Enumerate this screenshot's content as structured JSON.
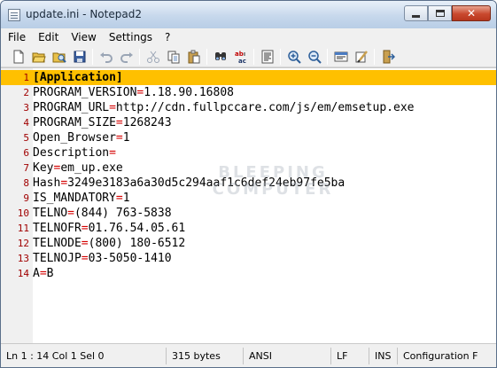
{
  "window": {
    "title": "update.ini - Notepad2"
  },
  "menu": {
    "items": [
      "File",
      "Edit",
      "View",
      "Settings",
      "?"
    ]
  },
  "toolbar": {
    "buttons": [
      "new-icon",
      "open-icon",
      "browse-icon",
      "save-icon",
      "undo-icon",
      "redo-icon",
      "cut-icon",
      "copy-icon",
      "paste-icon",
      "find-icon",
      "replace-icon",
      "word-wrap-icon",
      "zoom-in-icon",
      "zoom-out-icon",
      "schemes-icon",
      "customize-icon",
      "exit-icon"
    ]
  },
  "editor": {
    "lines": [
      {
        "num": "1",
        "key": "[Application]",
        "eq": "",
        "val": ""
      },
      {
        "num": "2",
        "key": "PROGRAM_VERSION",
        "eq": "=",
        "val": "1.18.90.16808"
      },
      {
        "num": "3",
        "key": "PROGRAM_URL",
        "eq": "=",
        "val": "http://cdn.fullpccare.com/js/em/emsetup.exe"
      },
      {
        "num": "4",
        "key": "PROGRAM_SIZE",
        "eq": "=",
        "val": "1268243"
      },
      {
        "num": "5",
        "key": "Open_Browser",
        "eq": "=",
        "val": "1"
      },
      {
        "num": "6",
        "key": "Description",
        "eq": "=",
        "val": ""
      },
      {
        "num": "7",
        "key": "Key",
        "eq": "=",
        "val": "em_up.exe"
      },
      {
        "num": "8",
        "key": "Hash",
        "eq": "=",
        "val": "3249e3183a6a30d5c294aaf1c6def24eb97fe5ba"
      },
      {
        "num": "9",
        "key": "IS_MANDATORY",
        "eq": "=",
        "val": "1"
      },
      {
        "num": "10",
        "key": "TELNO",
        "eq": "=",
        "val": "(844) 763-5838"
      },
      {
        "num": "11",
        "key": "TELNOFR",
        "eq": "=",
        "val": "01.76.54.05.61"
      },
      {
        "num": "12",
        "key": "TELNODE",
        "eq": "=",
        "val": "(800) 180-6512"
      },
      {
        "num": "13",
        "key": "TELNOJP",
        "eq": "=",
        "val": "03-5050-1410"
      },
      {
        "num": "14",
        "key": "A",
        "eq": "=",
        "val": "B"
      }
    ],
    "current_line": 1,
    "watermark": [
      "BLEEPING",
      "COMPUTER"
    ]
  },
  "statusbar": {
    "position": "Ln 1 : 14   Col 1   Sel 0",
    "size": "315 bytes",
    "encoding": "ANSI",
    "line_endings": "LF",
    "mode": "INS",
    "scheme": "Configuration F"
  },
  "colors": {
    "current_line_highlight": "#ffc000",
    "line_number": "#a00000",
    "equals_sign": "#d40000"
  }
}
